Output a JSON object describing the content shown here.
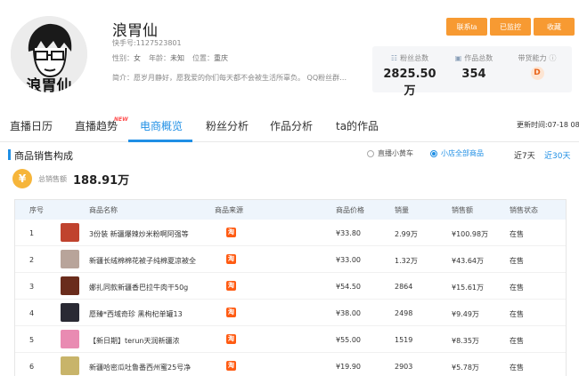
{
  "profile": {
    "name": "浪胃仙",
    "id": "快手号:1127523801",
    "gender_label": "性别：",
    "gender": "女",
    "age_label": "年龄：",
    "age": "未知",
    "location_label": "位置：",
    "location": "重庆",
    "bio_label": "简介：",
    "bio": "愿岁月静好，愿我爱的你们每天都不会被生活所辜负。 QQ粉丝群：51...",
    "avatar_lettering": "浪胃仙"
  },
  "buttons": {
    "contact": "联系ta",
    "monitor": "已监控",
    "favorite": "收藏"
  },
  "stats": [
    {
      "icon": "fans-icon",
      "label": "粉丝总数",
      "value": "2825.50万"
    },
    {
      "icon": "works-icon",
      "label": "作品总数",
      "value": "354"
    },
    {
      "icon": "",
      "label": "带货能力",
      "value": "D"
    }
  ],
  "tabs": [
    {
      "label": "直播日历",
      "active": false
    },
    {
      "label": "直播趋势",
      "active": false,
      "badge": "NEW"
    },
    {
      "label": "电商概览",
      "active": true
    },
    {
      "label": "粉丝分析",
      "active": false
    },
    {
      "label": "作品分析",
      "active": false
    },
    {
      "label": "ta的作品",
      "active": false
    }
  ],
  "update_time": "更新时间:07-18 08:00",
  "section": {
    "title": "商品销售构成",
    "filter_live": "直播小黄车",
    "filter_shop": "小店全部商品",
    "period_7": "近7天",
    "period_30": "近30天",
    "total_label": "总销售额",
    "total_value": "188.91万",
    "coin_symbol": "¥"
  },
  "table": {
    "headers": [
      "序号",
      "商品名称",
      "商品来源",
      "商品价格",
      "销量",
      "销售额",
      "销售状态"
    ],
    "source_glyph": "淘",
    "rows": [
      {
        "index": "1",
        "name": "3份装 新疆爆辣炒米粉啊阿强等",
        "price": "¥33.80",
        "sales": "2.99万",
        "revenue": "¥100.98万",
        "status": "在售",
        "thumb_color": "#c0432e"
      },
      {
        "index": "2",
        "name": "新疆长绒棉棉花被子纯棉夏凉被全",
        "price": "¥33.00",
        "sales": "1.32万",
        "revenue": "¥43.64万",
        "status": "在售",
        "thumb_color": "#b8a49a"
      },
      {
        "index": "3",
        "name": "娜扎同款新疆香巴拉牛肉干50g",
        "price": "¥54.50",
        "sales": "2864",
        "revenue": "¥15.61万",
        "status": "在售",
        "thumb_color": "#6a2c1c"
      },
      {
        "index": "4",
        "name": "愿臻*西域奇珍 黑枸杞单罐13",
        "price": "¥38.00",
        "sales": "2498",
        "revenue": "¥9.49万",
        "status": "在售",
        "thumb_color": "#2a2a34"
      },
      {
        "index": "5",
        "name": "【新日期】terun天润新疆浓",
        "price": "¥55.00",
        "sales": "1519",
        "revenue": "¥8.35万",
        "status": "在售",
        "thumb_color": "#e98bb2"
      },
      {
        "index": "6",
        "name": "新疆哈密瓜吐鲁番西州蜜25号净",
        "price": "¥19.90",
        "sales": "2903",
        "revenue": "¥5.78万",
        "status": "在售",
        "thumb_color": "#c8b46a"
      }
    ]
  },
  "colors": {
    "accent": "#1f8fe5",
    "button": "#f79a32",
    "taobao": "#ff5b12"
  }
}
